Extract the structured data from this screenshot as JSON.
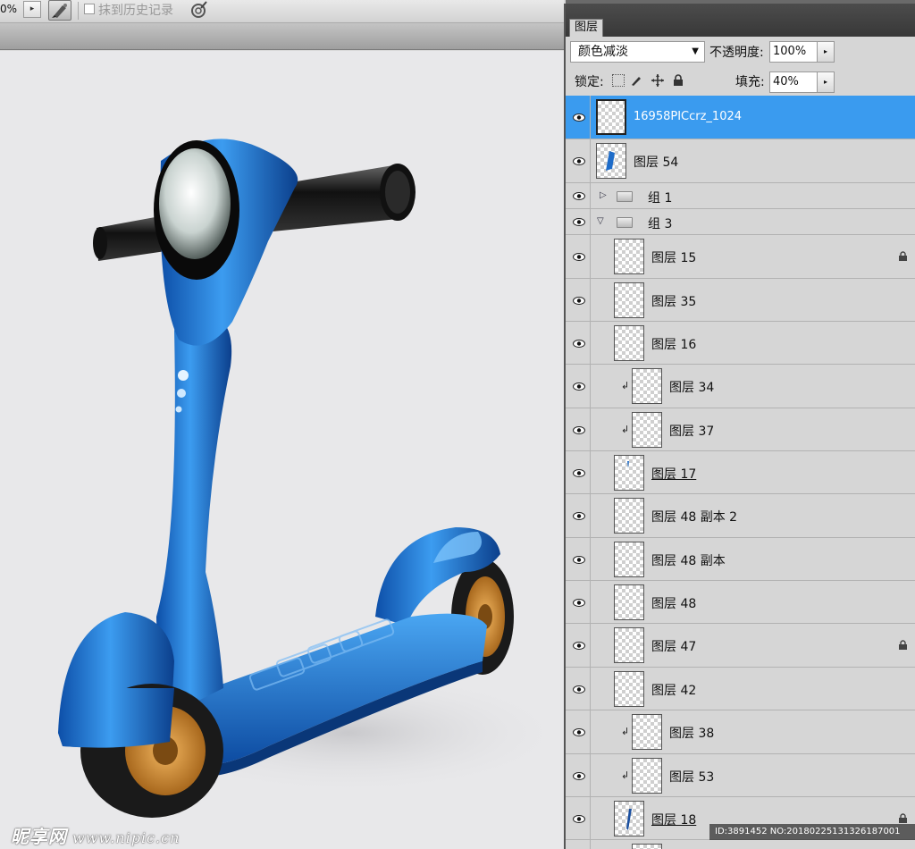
{
  "options_bar": {
    "zoom_fragment": "0%",
    "zoom_arrow": "▸",
    "erase_history_label": "抹到历史记录",
    "tablet_icon": "tablet-pressure-icon",
    "brush_icon": "airbrush-icon"
  },
  "canvas": {
    "watermark_brand": "昵享网",
    "watermark_url": "www.nipic.cn",
    "image_stamp": "ID:3891452 NO:20180225131326187001"
  },
  "layers_panel": {
    "tab_label": "图层",
    "blend_mode": "颜色减淡",
    "blend_arrow": "▼",
    "opacity_label": "不透明度:",
    "opacity_value": "100%",
    "lock_label": "锁定:",
    "fill_label": "填充:",
    "fill_value": "40%",
    "spin_arrow": "▸",
    "selected_color": "#3a9bef",
    "layers": [
      {
        "name": "16958PICcrz_1024",
        "selected": true,
        "locked": false,
        "clipped": false,
        "group": false
      },
      {
        "name": "图层 54",
        "selected": false,
        "locked": false,
        "clipped": false,
        "group": false
      },
      {
        "name": "组 1",
        "selected": false,
        "locked": false,
        "clipped": false,
        "group": true,
        "expanded": false
      },
      {
        "name": "组 3",
        "selected": false,
        "locked": false,
        "clipped": false,
        "group": true,
        "expanded": true
      },
      {
        "name": "图层 15",
        "selected": false,
        "locked": true,
        "clipped": false,
        "group": false
      },
      {
        "name": "图层 35",
        "selected": false,
        "locked": false,
        "clipped": false,
        "group": false
      },
      {
        "name": "图层 16",
        "selected": false,
        "locked": false,
        "clipped": false,
        "group": false
      },
      {
        "name": "图层 34",
        "selected": false,
        "locked": false,
        "clipped": true,
        "group": false
      },
      {
        "name": "图层 37",
        "selected": false,
        "locked": false,
        "clipped": true,
        "group": false
      },
      {
        "name": "图层 17",
        "selected": false,
        "locked": false,
        "clipped": false,
        "group": false
      },
      {
        "name": "图层 48 副本 2",
        "selected": false,
        "locked": false,
        "clipped": false,
        "group": false
      },
      {
        "name": "图层 48 副本",
        "selected": false,
        "locked": false,
        "clipped": false,
        "group": false
      },
      {
        "name": "图层 48",
        "selected": false,
        "locked": false,
        "clipped": false,
        "group": false
      },
      {
        "name": "图层 47",
        "selected": false,
        "locked": true,
        "clipped": false,
        "group": false
      },
      {
        "name": "图层 42",
        "selected": false,
        "locked": false,
        "clipped": false,
        "group": false
      },
      {
        "name": "图层 38",
        "selected": false,
        "locked": false,
        "clipped": true,
        "group": false
      },
      {
        "name": "图层 53",
        "selected": false,
        "locked": false,
        "clipped": true,
        "group": false
      },
      {
        "name": "图层 18",
        "selected": false,
        "locked": true,
        "clipped": false,
        "group": false
      }
    ]
  }
}
